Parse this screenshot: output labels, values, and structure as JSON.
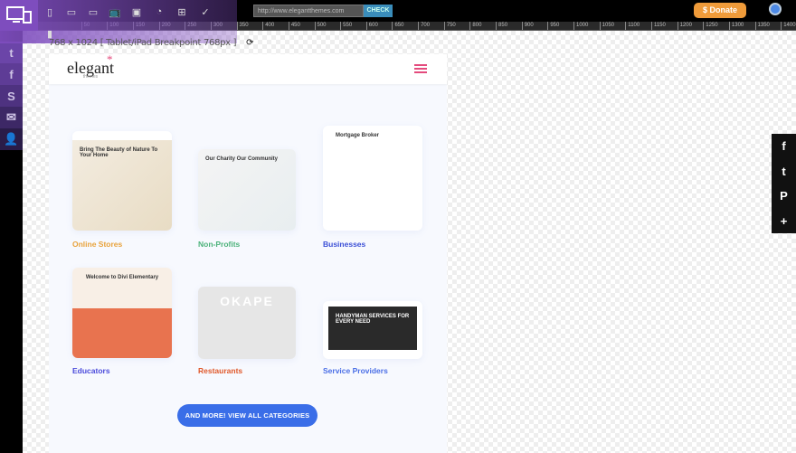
{
  "toolbar": {
    "url_value": "http://www.elegantthemes.com",
    "check_label": "CHECK",
    "donate_label": "$ Donate",
    "breakpoint_label": "768 x 1024 [ Tablet/iPad Breakpoint 768px ]",
    "refresh_icon": "⟳"
  },
  "ruler_ticks": [
    "50",
    "100",
    "150",
    "200",
    "250",
    "300",
    "350",
    "400",
    "450",
    "500",
    "550",
    "600",
    "650",
    "700",
    "750",
    "800",
    "850",
    "900",
    "950",
    "1000",
    "1050",
    "1100",
    "1150",
    "1200",
    "1250",
    "1300",
    "1350",
    "1400"
  ],
  "left_social": [
    "t",
    "f",
    "S",
    "✉",
    "👤"
  ],
  "site": {
    "logo": "elegant",
    "logo_sub": "themes"
  },
  "categories": [
    {
      "label": "Online Stores",
      "color": "#e8a23b",
      "preview": "Bring The Beauty of Nature To Your Home"
    },
    {
      "label": "Non-Profits",
      "color": "#4cb27a",
      "preview": "Our Charity Our Community"
    },
    {
      "label": "Businesses",
      "color": "#3b4fd6",
      "preview": "Mortgage Broker"
    },
    {
      "label": "Educators",
      "color": "#4a4adb",
      "preview": "Welcome to Divi Elementary"
    },
    {
      "label": "Restaurants",
      "color": "#e0582a",
      "preview": "OKAPE"
    },
    {
      "label": "Service Providers",
      "color": "#4a6ee6",
      "preview": "HANDYMAN SERVICES FOR EVERY NEED"
    }
  ],
  "cta": {
    "label": "AND MORE! VIEW ALL CATEGORIES"
  },
  "share": [
    "f",
    "t",
    "P",
    "+"
  ]
}
